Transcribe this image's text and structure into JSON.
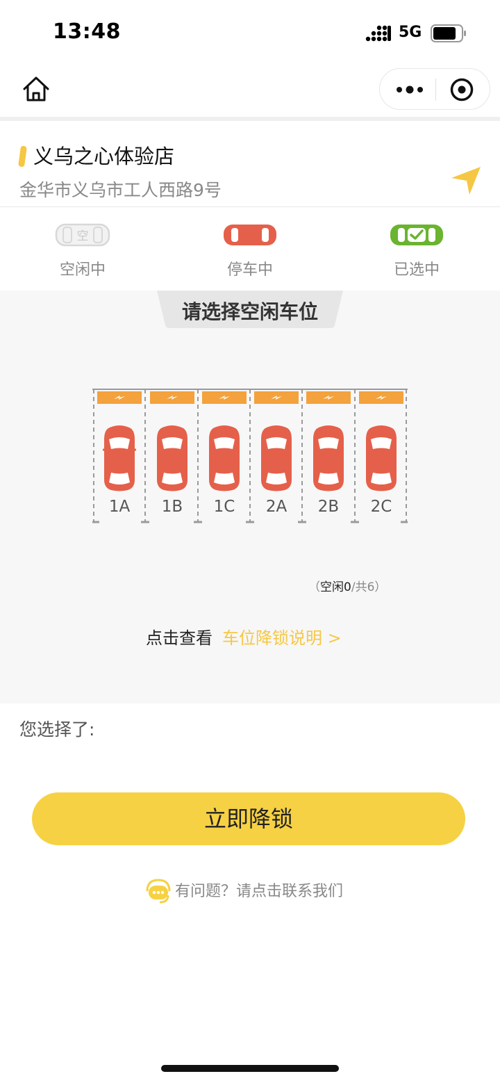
{
  "status_bar": {
    "time": "13:48",
    "network": "5G"
  },
  "store": {
    "name": "义乌之心体验店",
    "address": "金华市义乌市工人西路9号"
  },
  "legend": [
    {
      "name": "free",
      "label": "空闲中",
      "icon_text": "空",
      "color": "#d8d8d8"
    },
    {
      "name": "parked",
      "label": "停车中",
      "color": "#e5604a"
    },
    {
      "name": "selected",
      "label": "已选中",
      "color": "#6ab42f"
    }
  ],
  "lot": {
    "title": "请选择空闲车位",
    "slots": [
      {
        "id": "1A",
        "status": "parked"
      },
      {
        "id": "1B",
        "status": "parked"
      },
      {
        "id": "1C",
        "status": "parked"
      },
      {
        "id": "2A",
        "status": "parked"
      },
      {
        "id": "2B",
        "status": "parked"
      },
      {
        "id": "2C",
        "status": "parked"
      }
    ],
    "free_count": {
      "open": "（",
      "free_label": "空闲",
      "free": "0",
      "slash": "/",
      "total_label": "共",
      "total": "6",
      "close": "）"
    },
    "explain_prefix": "点击查看",
    "explain_link": "车位降锁说明 >"
  },
  "selection": {
    "label": "您选择了:"
  },
  "unlock_button": {
    "label": "立即降锁"
  },
  "contact": {
    "text": "有问题？请点击联系我们",
    "icon": "headset-icon"
  },
  "colors": {
    "accent": "#f6d143",
    "link": "#f6c744",
    "parked": "#e5604a",
    "charger": "#f3a23d",
    "selected": "#6ab42f"
  }
}
